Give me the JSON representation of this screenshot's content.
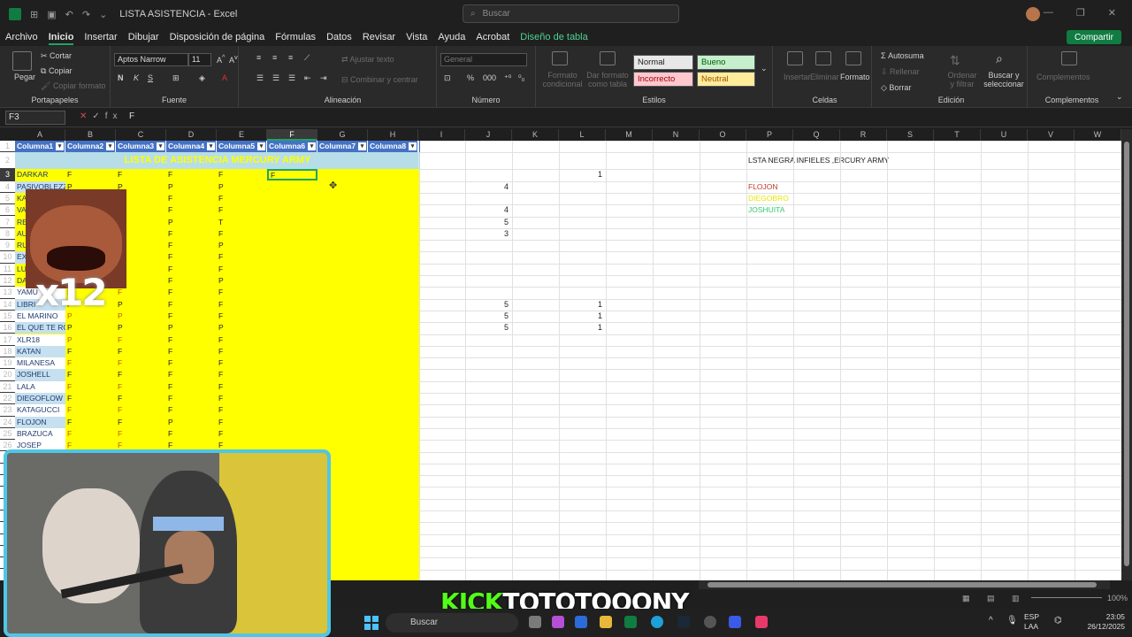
{
  "window": {
    "title": "LISTA ASISTENCIA  -  Excel",
    "search_placeholder": "Buscar",
    "minimize": "—",
    "maximize": "❐",
    "close": "✕"
  },
  "menu": [
    "Archivo",
    "Inicio",
    "Insertar",
    "Dibujar",
    "Disposición de página",
    "Fórmulas",
    "Datos",
    "Revisar",
    "Vista",
    "Ayuda",
    "Acrobat",
    "Diseño de tabla"
  ],
  "share_label": "Compartir",
  "ribbon": {
    "paste": "Pegar",
    "cut": "Cortar",
    "copy": "Copiar",
    "copy_format": "Copiar formato",
    "clipboard_label": "Portapapeles",
    "font_name": "Aptos Narrow",
    "font_size": "11",
    "font_label": "Fuente",
    "wrap_text": "Ajustar texto",
    "merge_center": "Combinar y centrar",
    "alignment_label": "Alineación",
    "number_format": "General",
    "number_label": "Número",
    "conditional_format": "Formato condicional",
    "format_table": "Dar formato como tabla",
    "style_normal": "Normal",
    "style_good": "Bueno",
    "style_bad": "Incorrecto",
    "style_neutral": "Neutral",
    "styles_label": "Estilos",
    "insert": "Insertar",
    "delete": "Eliminar",
    "format": "Formato",
    "cells_label": "Celdas",
    "autosum": "Autosuma",
    "fill": "Rellenar",
    "clear": "Borrar",
    "sort_filter": "Ordenar y filtrar",
    "find_select": "Buscar y seleccionar",
    "edit_label": "Edición",
    "addins": "Complementos",
    "addins_label": "Complementos"
  },
  "formula_bar": {
    "name_box": "F3",
    "content": "F"
  },
  "columns": [
    "A",
    "B",
    "C",
    "D",
    "E",
    "F",
    "G",
    "H",
    "I",
    "J",
    "K",
    "L",
    "M",
    "N",
    "O",
    "P",
    "Q",
    "R",
    "S",
    "T",
    "U",
    "V",
    "W"
  ],
  "table_headers": [
    "Columna1",
    "Columna2",
    "Columna3",
    "Columna4",
    "Columna5",
    "Columna6",
    "Columna7",
    "Columna8"
  ],
  "row2_title": "LISTA DE ASISTENCIA MERCURY ARMY",
  "rows": [
    {
      "n": "3",
      "name": "DARKAR",
      "b": "F",
      "c": "F",
      "d": "F",
      "e": "F"
    },
    {
      "n": "4",
      "name": "PASIVOBLEZZ",
      "b": "P",
      "c": "P",
      "d": "P",
      "e": "P"
    },
    {
      "n": "5",
      "name": "KA",
      "b": "",
      "c": "",
      "d": "F",
      "e": "F"
    },
    {
      "n": "6",
      "name": "VA",
      "b": "",
      "c": "",
      "d": "F",
      "e": "F"
    },
    {
      "n": "7",
      "name": "RE",
      "b": "",
      "c": "",
      "d": "P",
      "e": "T"
    },
    {
      "n": "8",
      "name": "AU",
      "b": "",
      "c": "",
      "d": "F",
      "e": "F"
    },
    {
      "n": "9",
      "name": "RU",
      "b": "",
      "c": "",
      "d": "F",
      "e": "P"
    },
    {
      "n": "10",
      "name": "EX",
      "b": "",
      "c": "",
      "d": "F",
      "e": "F"
    },
    {
      "n": "11",
      "name": "LU",
      "b": "",
      "c": "",
      "d": "F",
      "e": "F"
    },
    {
      "n": "12",
      "name": "DA",
      "b": "",
      "c": "",
      "d": "F",
      "e": "P"
    },
    {
      "n": "13",
      "name": "YAMU",
      "b": "F",
      "c": "F",
      "d": "F",
      "e": "F"
    },
    {
      "n": "14",
      "name": "LIBRI",
      "b": "F",
      "c": "P",
      "d": "F",
      "e": "F"
    },
    {
      "n": "15",
      "name": "EL MARINO",
      "b": "P",
      "c": "P",
      "d": "F",
      "e": "F"
    },
    {
      "n": "16",
      "name": "EL QUE TE ROMPE",
      "b": "P",
      "c": "P",
      "d": "P",
      "e": "P"
    },
    {
      "n": "17",
      "name": "XLR18",
      "b": "P",
      "c": "F",
      "d": "F",
      "e": "F"
    },
    {
      "n": "18",
      "name": "KATAN",
      "b": "F",
      "c": "F",
      "d": "F",
      "e": "F"
    },
    {
      "n": "19",
      "name": "MILANESA",
      "b": "F",
      "c": "F",
      "d": "F",
      "e": "F"
    },
    {
      "n": "20",
      "name": "JOSHELL",
      "b": "F",
      "c": "F",
      "d": "F",
      "e": "F"
    },
    {
      "n": "21",
      "name": "LALA",
      "b": "F",
      "c": "F",
      "d": "F",
      "e": "F"
    },
    {
      "n": "22",
      "name": "DIEGOFLOW",
      "b": "F",
      "c": "F",
      "d": "F",
      "e": "F"
    },
    {
      "n": "23",
      "name": "KATAGUCCI",
      "b": "F",
      "c": "F",
      "d": "F",
      "e": "F"
    },
    {
      "n": "24",
      "name": "FLOJON",
      "b": "F",
      "c": "F",
      "d": "P",
      "e": "F"
    },
    {
      "n": "25",
      "name": "BRAZUCA",
      "b": "F",
      "c": "F",
      "d": "F",
      "e": "F"
    },
    {
      "n": "26",
      "name": "JOSEP",
      "b": "F",
      "c": "F",
      "d": "F",
      "e": "F"
    }
  ],
  "side_numbers": {
    "l3": "1",
    "j4": "4",
    "j6": "4",
    "j7": "5",
    "j8": "3",
    "j14": "5",
    "l14": "1",
    "j15": "5",
    "l15": "1",
    "j16": "5",
    "l16": "1"
  },
  "blacklist": {
    "title": "LSTA NEGRA INFIELES ,ERCURY ARMY",
    "names": [
      "FLOJON",
      "DIEGOBRO",
      "JOSHUITA"
    ],
    "colors": [
      "#c0392b",
      "#e8e800",
      "#2ecc71"
    ]
  },
  "selected_cell_value": "F",
  "overlay": {
    "multiplier": "x12",
    "kick_brand": "KICK",
    "kick_user": "TOTOTOOONY"
  },
  "taskbar": {
    "search": "Buscar",
    "lang1": "ESP",
    "lang2": "LAA",
    "time": "23:05",
    "date": "26/12/2025"
  },
  "status": {
    "zoom": "100%"
  }
}
